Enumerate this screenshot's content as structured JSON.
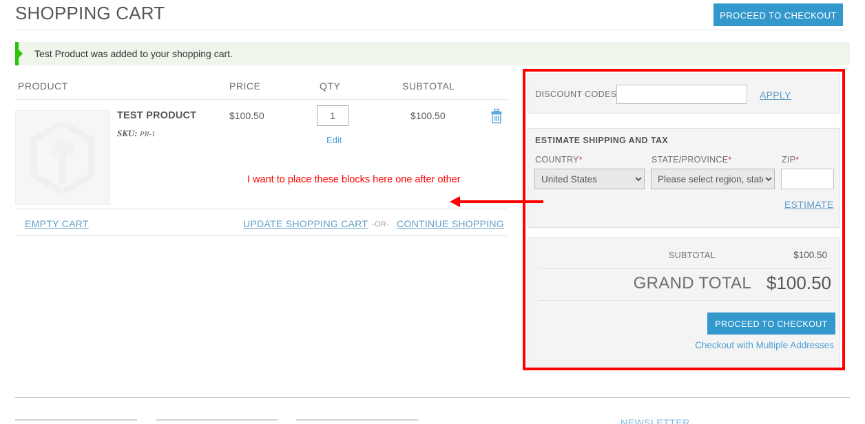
{
  "header": {
    "title": "SHOPPING CART",
    "checkout_button": "PROCEED TO CHECKOUT"
  },
  "message": {
    "text": "Test Product was added to your shopping cart.",
    "type": "success",
    "accent_color": "#2cc40a",
    "background": "#eff5ea"
  },
  "cart_table": {
    "columns": {
      "product": "PRODUCT",
      "price": "PRICE",
      "qty": "QTY",
      "subtotal": "SUBTOTAL"
    },
    "rows": [
      {
        "name": "TEST PRODUCT",
        "sku_label": "SKU:",
        "sku_value": "PR-1",
        "price": "$100.50",
        "qty": "1",
        "edit_link": "Edit",
        "subtotal": "$100.50",
        "remove_icon": "trash-icon",
        "thumbnail_icon": "magento-placeholder-icon"
      }
    ]
  },
  "annotation": {
    "note_text": "I want to place these blocks here one after other",
    "color": "#ff0000",
    "arrow_icon": "left-arrow-annotation",
    "box_icon": "red-highlight-box"
  },
  "cart_actions": {
    "empty_cart": "EMPTY CART",
    "update_cart": "UPDATE SHOPPING CART",
    "separator": "-OR-",
    "continue_shopping": "CONTINUE SHOPPING"
  },
  "summary": {
    "discount": {
      "label": "DISCOUNT CODES",
      "input_value": "",
      "input_placeholder": "",
      "apply_link": "APPLY"
    },
    "estimate": {
      "title": "ESTIMATE SHIPPING AND TAX",
      "country_label": "COUNTRY",
      "country_value": "United States",
      "state_label": "STATE/PROVINCE",
      "state_value": "Please select region, state",
      "zip_label": "ZIP",
      "zip_value": "",
      "zip_placeholder": "",
      "required_marker": "*",
      "estimate_link": "ESTIMATE"
    },
    "totals": {
      "subtotal_label": "SUBTOTAL",
      "subtotal_value": "$100.50",
      "grand_total_label": "GRAND TOTAL",
      "grand_total_value": "$100.50"
    },
    "checkout_button": "PROCEED TO CHECKOUT",
    "multiple_addresses_link": "Checkout with Multiple Addresses"
  },
  "footer": {
    "newsletter_label": "NEWSLETTER"
  },
  "colors": {
    "primary_button": "#3399cc",
    "link": "#5f9dc7",
    "text": "#575757",
    "annotation_red": "#fe0000",
    "success_green": "#2cc40a"
  }
}
